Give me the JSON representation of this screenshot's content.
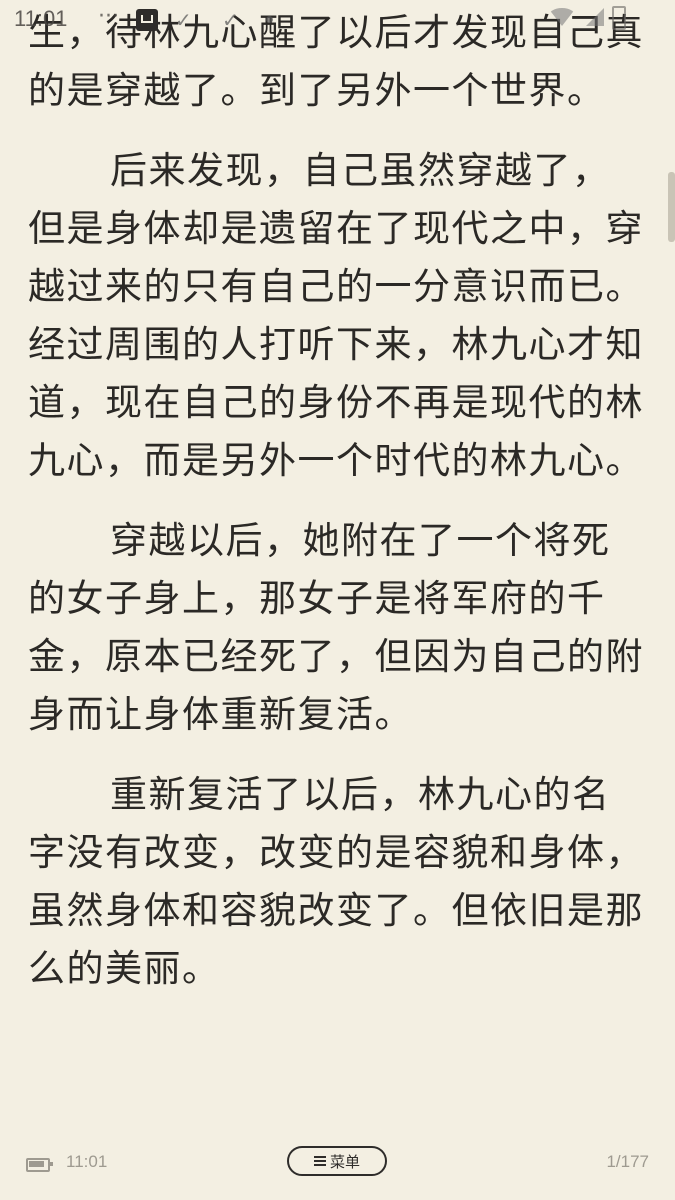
{
  "status_bar": {
    "time": "11:01",
    "dots": "···"
  },
  "content": {
    "paragraphs": [
      "生，待林九心醒了以后才发现自己真的是穿越了。到了另外一个世界。",
      "后来发现，自己虽然穿越了，但是身体却是遗留在了现代之中，穿越过来的只有自己的一分意识而已。经过周围的人打听下来，林九心才知道，现在自己的身份不再是现代的林九心，而是另外一个时代的林九心。",
      "穿越以后，她附在了一个将死的女子身上，那女子是将军府的千金，原本已经死了，但因为自己的附身而让身体重新复活。",
      "重新复活了以后，林九心的名字没有改变，改变的是容貌和身体，虽然身体和容貌改变了。但依旧是那么的美丽。"
    ]
  },
  "bottom_bar": {
    "time": "11:01",
    "menu_label": "菜单",
    "page_indicator": "1/177"
  }
}
